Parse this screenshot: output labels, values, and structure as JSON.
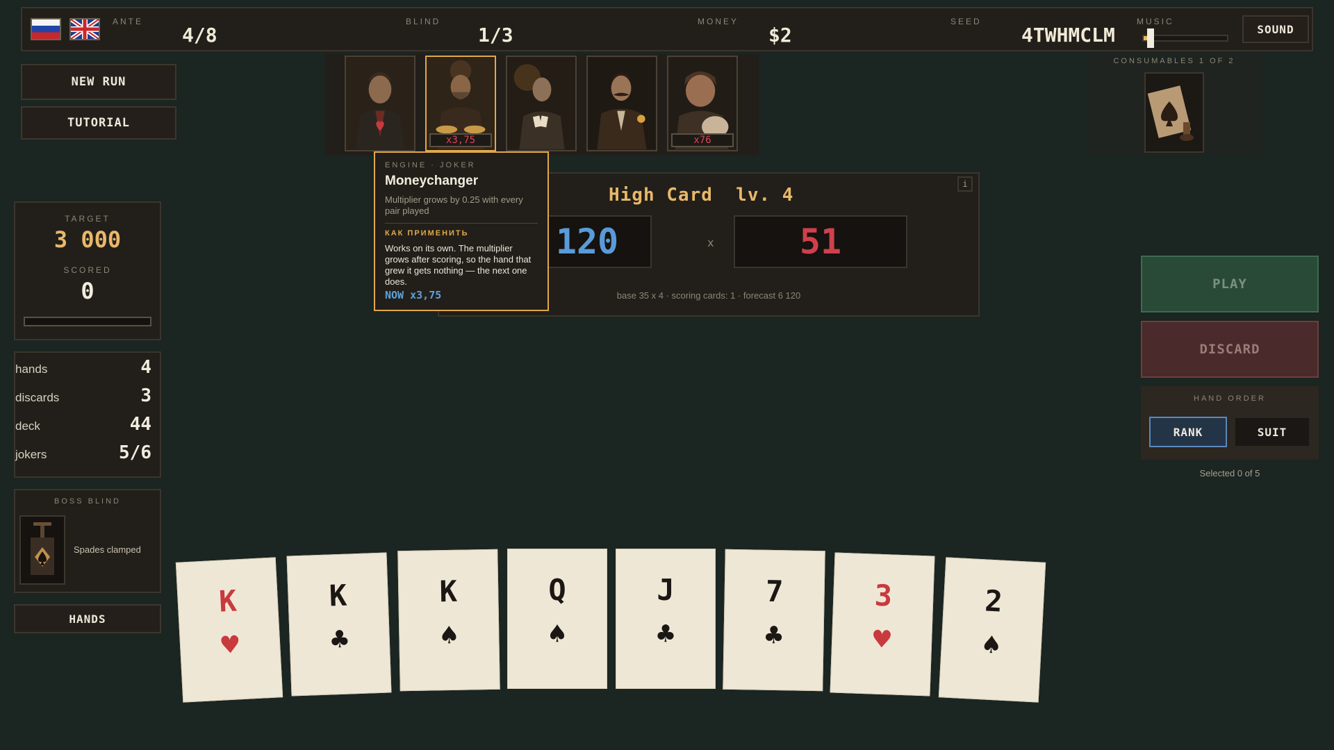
{
  "topbar": {
    "flags": [
      {
        "name": "russian-flag"
      },
      {
        "name": "uk-flag"
      }
    ],
    "ante": {
      "label": "ANTE",
      "value": "4/8"
    },
    "blind": {
      "label": "BLIND",
      "value": "1/3"
    },
    "money": {
      "label": "MONEY",
      "value": "$2"
    },
    "seed": {
      "label": "SEED",
      "value": "4TWHMCLM"
    },
    "music": {
      "label": "MUSIC",
      "level": 0.06
    },
    "sound_label": "SOUND"
  },
  "menu": {
    "new_run": "NEW RUN",
    "tutorial": "TUTORIAL"
  },
  "jokers": [
    {
      "name": "heart-joker",
      "badge": ""
    },
    {
      "name": "moneychanger",
      "badge": "x3,75",
      "selected": true
    },
    {
      "name": "card-player-joker",
      "badge": ""
    },
    {
      "name": "mustache-joker",
      "badge": ""
    },
    {
      "name": "hog-joker",
      "badge": "x76"
    }
  ],
  "consumables": {
    "label": "CONSUMABLES 1 OF 2"
  },
  "tooltip": {
    "category": "ENGINE · JOKER",
    "title": "Moneychanger",
    "desc": "Multiplier grows by 0.25 with every pair played",
    "how_header": "КАК ПРИМЕНИТЬ",
    "how_body": "Works on its own. The multiplier grows after scoring, so the hand that grew it gets nothing — the next one does.",
    "now": "NOW x3,75"
  },
  "hand_info": {
    "name": "High Card  lv. 4",
    "chips": "120",
    "times": "x",
    "mult": "51",
    "footer": "base 35 x 4  ·  scoring cards: 1  ·  forecast  6 120",
    "info_label": "i"
  },
  "target": {
    "label": "TARGET",
    "value": "3 000",
    "scored_label": "SCORED",
    "scored": "0",
    "progress": 0
  },
  "stats": [
    {
      "name": "hands",
      "value": "4"
    },
    {
      "name": "discards",
      "value": "3"
    },
    {
      "name": "deck",
      "value": "44"
    },
    {
      "name": "jokers",
      "value": "5/6"
    }
  ],
  "boss": {
    "label": "BOSS BLIND",
    "text": "Spades clamped"
  },
  "hands_button": "HANDS",
  "actions": {
    "play": "PLAY",
    "discard": "DISCARD"
  },
  "hand_order": {
    "label": "HAND ORDER",
    "rank": "RANK",
    "suit": "SUIT",
    "selected_text": "Selected 0 of 5"
  },
  "hand_cards": [
    {
      "rank": "K",
      "suit": "♥",
      "color": "red"
    },
    {
      "rank": "K",
      "suit": "♣",
      "color": "blk"
    },
    {
      "rank": "K",
      "suit": "♠",
      "color": "blk"
    },
    {
      "rank": "Q",
      "suit": "♠",
      "color": "blk"
    },
    {
      "rank": "J",
      "suit": "♣",
      "color": "blk"
    },
    {
      "rank": "7",
      "suit": "♣",
      "color": "blk"
    },
    {
      "rank": "3",
      "suit": "♥",
      "color": "red"
    },
    {
      "rank": "2",
      "suit": "♠",
      "color": "blk"
    }
  ],
  "colors": {
    "background": "#1b2521",
    "accent": "#e2a84a",
    "chips": "#5a9ad8",
    "mult": "#d0404c",
    "play": "#2a4a38",
    "discard": "#4a2a2a"
  }
}
